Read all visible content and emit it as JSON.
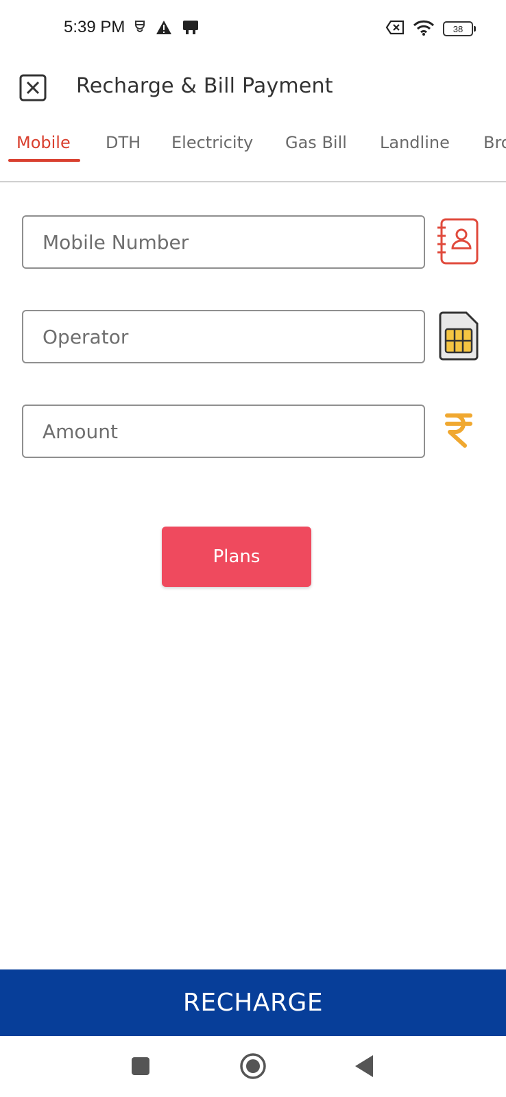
{
  "status_bar": {
    "time": "5:39 PM",
    "battery_level": "38"
  },
  "header": {
    "title": "Recharge & Bill Payment"
  },
  "tabs": [
    {
      "label": "Mobile",
      "active": true
    },
    {
      "label": "DTH",
      "active": false
    },
    {
      "label": "Electricity",
      "active": false
    },
    {
      "label": "Gas Bill",
      "active": false
    },
    {
      "label": "Landline",
      "active": false
    },
    {
      "label": "Bro",
      "active": false
    }
  ],
  "form": {
    "mobile_number": {
      "placeholder": "Mobile Number",
      "value": "",
      "icon": "contact-book-icon"
    },
    "operator": {
      "placeholder": "Operator",
      "value": "",
      "icon": "sim-card-icon"
    },
    "amount": {
      "placeholder": "Amount",
      "value": "",
      "icon": "rupee-icon"
    }
  },
  "plans_button": {
    "label": "Plans"
  },
  "recharge_button": {
    "label": "RECHARGE"
  },
  "colors": {
    "accent_red": "#d9402f",
    "plans_button": "#ef4a5e",
    "recharge_bar": "#073e99",
    "rupee_orange": "#f0a830",
    "sim_yellow": "#f5c542"
  }
}
